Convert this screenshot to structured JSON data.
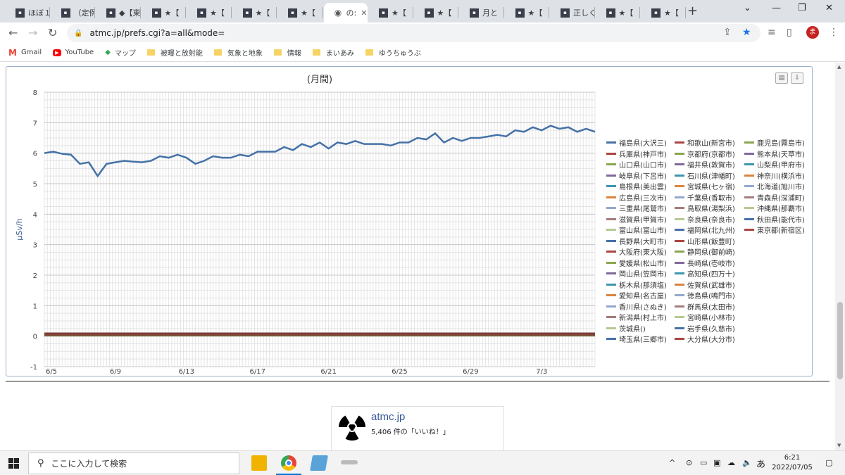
{
  "tabs": [
    {
      "label": "ほぼ１"
    },
    {
      "label": "（定例"
    },
    {
      "label": "◆【東"
    },
    {
      "label": "★【"
    },
    {
      "label": "★【"
    },
    {
      "label": "★【"
    },
    {
      "label": "★【"
    },
    {
      "label": "の:",
      "active": true
    },
    {
      "label": "★【"
    },
    {
      "label": "★【"
    },
    {
      "label": "月と"
    },
    {
      "label": "★【"
    },
    {
      "label": "正しく"
    },
    {
      "label": "★【"
    },
    {
      "label": "★【"
    }
  ],
  "toolbar": {
    "url": "atmc.jp/prefs.cgi?a=all&mode=",
    "avatar": "ま"
  },
  "bookmarks": [
    {
      "label": "Gmail",
      "icon": "gmail-icon",
      "color": "#ea4335"
    },
    {
      "label": "YouTube",
      "icon": "youtube-icon",
      "color": "#ff0000"
    },
    {
      "label": "マップ",
      "icon": "maps-icon",
      "color": "#34a853"
    },
    {
      "label": "被曝と放射能",
      "icon": "folder-icon"
    },
    {
      "label": "気象と地象",
      "icon": "folder-icon"
    },
    {
      "label": "情報",
      "icon": "folder-icon"
    },
    {
      "label": "まいあみ",
      "icon": "folder-icon"
    },
    {
      "label": "ゆうちゅうぶ",
      "icon": "folder-icon"
    }
  ],
  "chart_data": {
    "type": "line",
    "title": "(月間)",
    "ylabel": "µSv/h",
    "xlabel": "",
    "ylim": [
      -1,
      8
    ],
    "yticks": [
      "8",
      "7",
      "6",
      "5",
      "4",
      "3",
      "2",
      "1",
      "0",
      "-1"
    ],
    "xticks": [
      "6/5",
      "6/9",
      "6/13",
      "6/17",
      "6/21",
      "6/25",
      "6/29",
      "7/3"
    ],
    "grid": true,
    "legend_position": "right",
    "series": [
      {
        "name": "福島県(大沢三)",
        "color": "#4572a7",
        "values": [
          6.0,
          6.05,
          5.98,
          5.95,
          5.65,
          5.7,
          5.25,
          5.65,
          5.7,
          5.75,
          5.72,
          5.7,
          5.75,
          5.9,
          5.85,
          5.95,
          5.85,
          5.65,
          5.75,
          5.9,
          5.85,
          5.85,
          5.95,
          5.9,
          6.05,
          6.05,
          6.05,
          6.2,
          6.1,
          6.3,
          6.2,
          6.35,
          6.15,
          6.35,
          6.3,
          6.4,
          6.3,
          6.3,
          6.3,
          6.25,
          6.35,
          6.35,
          6.5,
          6.45,
          6.65,
          6.35,
          6.5,
          6.4,
          6.5,
          6.5,
          6.55,
          6.6,
          6.55,
          6.75,
          6.7,
          6.85,
          6.75,
          6.9,
          6.8,
          6.85,
          6.7,
          6.8,
          6.7
        ]
      },
      {
        "name": "和歌山(新宮市)",
        "color": "#aa4643",
        "values": [
          0.08,
          0.08,
          0.08,
          0.08,
          0.08,
          0.08,
          0.08,
          0.08
        ]
      },
      {
        "name": "鹿児島(霧島市)",
        "color": "#89a54e",
        "values": [
          0.06,
          0.06,
          0.06,
          0.06,
          0.06,
          0.06,
          0.06,
          0.06
        ]
      }
    ],
    "legend": [
      [
        "福島県(大沢三)",
        "#4572a7"
      ],
      [
        "和歌山(新宮市)",
        "#aa4643"
      ],
      [
        "鹿児島(霧島市)",
        "#89a54e"
      ],
      [
        "兵庫県(神戸市)",
        "#aa4643"
      ],
      [
        "京都府(京都市)",
        "#89a54e"
      ],
      [
        "熊本県(天草市)",
        "#80699b"
      ],
      [
        "山口県(山口市)",
        "#89a54e"
      ],
      [
        "福井県(敦賀市)",
        "#80699b"
      ],
      [
        "山梨県(甲府市)",
        "#3d96ae"
      ],
      [
        "岐阜県(下呂市)",
        "#80699b"
      ],
      [
        "石川県(津幡町)",
        "#3d96ae"
      ],
      [
        "神奈川(横浜市)",
        "#db843d"
      ],
      [
        "島根県(美出雲)",
        "#3d96ae"
      ],
      [
        "宮城県(七ヶ宿)",
        "#db843d"
      ],
      [
        "北海道(旭川市)",
        "#92a8cd"
      ],
      [
        "広島県(三次市)",
        "#db843d"
      ],
      [
        "千葉県(香取市)",
        "#92a8cd"
      ],
      [
        "青森県(深浦町)",
        "#a47d7c"
      ],
      [
        "三重県(尾鷲市)",
        "#92a8cd"
      ],
      [
        "鳥取県(湯梨浜)",
        "#a47d7c"
      ],
      [
        "沖縄県(那覇市)",
        "#b5ca92"
      ],
      [
        "滋賀県(甲賀市)",
        "#a47d7c"
      ],
      [
        "奈良県(奈良市)",
        "#b5ca92"
      ],
      [
        "秋田県(能代市)",
        "#4572a7"
      ],
      [
        "富山県(富山市)",
        "#b5ca92"
      ],
      [
        "福岡県(北九州)",
        "#4572a7"
      ],
      [
        "東京都(新宿区)",
        "#aa4643"
      ],
      [
        "長野県(大町市)",
        "#4572a7"
      ],
      [
        "山形県(飯豊町)",
        "#aa4643"
      ],
      [
        "大阪府(東大阪)",
        "#aa4643"
      ],
      [
        "静岡県(御前崎)",
        "#89a54e"
      ],
      [
        "愛媛県(松山市)",
        "#89a54e"
      ],
      [
        "長崎県(壱岐市)",
        "#80699b"
      ],
      [
        "岡山県(笠岡市)",
        "#80699b"
      ],
      [
        "高知県(四万十)",
        "#3d96ae"
      ],
      [
        "栃木県(那須塩)",
        "#3d96ae"
      ],
      [
        "佐賀県(武雄市)",
        "#db843d"
      ],
      [
        "愛知県(名古屋)",
        "#db843d"
      ],
      [
        "徳島県(鳴門市)",
        "#92a8cd"
      ],
      [
        "香川県(さぬき)",
        "#92a8cd"
      ],
      [
        "群馬県(太田市)",
        "#a47d7c"
      ],
      [
        "新潟県(村上市)",
        "#a47d7c"
      ],
      [
        "宮崎県(小林市)",
        "#b5ca92"
      ],
      [
        "茨城県()",
        "#b5ca92"
      ],
      [
        "岩手県(久慈市)",
        "#4572a7"
      ],
      [
        "埼玉県(三郷市)",
        "#4572a7"
      ],
      [
        "大分県(大分市)",
        "#aa4643"
      ]
    ]
  },
  "fb": {
    "name": "atmc.jp",
    "likes": "5,406 件の「いいね！」"
  },
  "taskbar": {
    "search_placeholder": "ここに入力して検索",
    "time": "6:21",
    "date": "2022/07/05",
    "ime": "あ"
  }
}
